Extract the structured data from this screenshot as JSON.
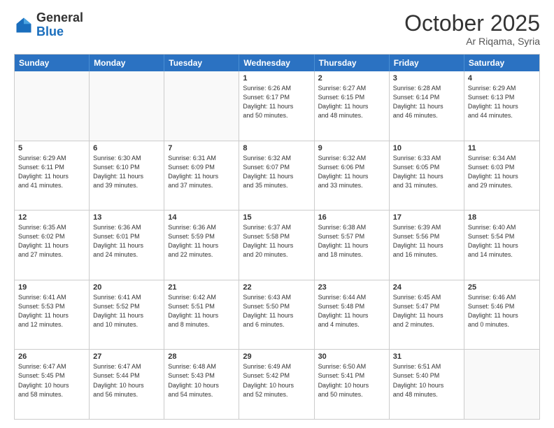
{
  "header": {
    "logo_general": "General",
    "logo_blue": "Blue",
    "month_title": "October 2025",
    "location": "Ar Riqama, Syria"
  },
  "days_of_week": [
    "Sunday",
    "Monday",
    "Tuesday",
    "Wednesday",
    "Thursday",
    "Friday",
    "Saturday"
  ],
  "weeks": [
    [
      {
        "day": "",
        "info": ""
      },
      {
        "day": "",
        "info": ""
      },
      {
        "day": "",
        "info": ""
      },
      {
        "day": "1",
        "info": "Sunrise: 6:26 AM\nSunset: 6:17 PM\nDaylight: 11 hours\nand 50 minutes."
      },
      {
        "day": "2",
        "info": "Sunrise: 6:27 AM\nSunset: 6:15 PM\nDaylight: 11 hours\nand 48 minutes."
      },
      {
        "day": "3",
        "info": "Sunrise: 6:28 AM\nSunset: 6:14 PM\nDaylight: 11 hours\nand 46 minutes."
      },
      {
        "day": "4",
        "info": "Sunrise: 6:29 AM\nSunset: 6:13 PM\nDaylight: 11 hours\nand 44 minutes."
      }
    ],
    [
      {
        "day": "5",
        "info": "Sunrise: 6:29 AM\nSunset: 6:11 PM\nDaylight: 11 hours\nand 41 minutes."
      },
      {
        "day": "6",
        "info": "Sunrise: 6:30 AM\nSunset: 6:10 PM\nDaylight: 11 hours\nand 39 minutes."
      },
      {
        "day": "7",
        "info": "Sunrise: 6:31 AM\nSunset: 6:09 PM\nDaylight: 11 hours\nand 37 minutes."
      },
      {
        "day": "8",
        "info": "Sunrise: 6:32 AM\nSunset: 6:07 PM\nDaylight: 11 hours\nand 35 minutes."
      },
      {
        "day": "9",
        "info": "Sunrise: 6:32 AM\nSunset: 6:06 PM\nDaylight: 11 hours\nand 33 minutes."
      },
      {
        "day": "10",
        "info": "Sunrise: 6:33 AM\nSunset: 6:05 PM\nDaylight: 11 hours\nand 31 minutes."
      },
      {
        "day": "11",
        "info": "Sunrise: 6:34 AM\nSunset: 6:03 PM\nDaylight: 11 hours\nand 29 minutes."
      }
    ],
    [
      {
        "day": "12",
        "info": "Sunrise: 6:35 AM\nSunset: 6:02 PM\nDaylight: 11 hours\nand 27 minutes."
      },
      {
        "day": "13",
        "info": "Sunrise: 6:36 AM\nSunset: 6:01 PM\nDaylight: 11 hours\nand 24 minutes."
      },
      {
        "day": "14",
        "info": "Sunrise: 6:36 AM\nSunset: 5:59 PM\nDaylight: 11 hours\nand 22 minutes."
      },
      {
        "day": "15",
        "info": "Sunrise: 6:37 AM\nSunset: 5:58 PM\nDaylight: 11 hours\nand 20 minutes."
      },
      {
        "day": "16",
        "info": "Sunrise: 6:38 AM\nSunset: 5:57 PM\nDaylight: 11 hours\nand 18 minutes."
      },
      {
        "day": "17",
        "info": "Sunrise: 6:39 AM\nSunset: 5:56 PM\nDaylight: 11 hours\nand 16 minutes."
      },
      {
        "day": "18",
        "info": "Sunrise: 6:40 AM\nSunset: 5:54 PM\nDaylight: 11 hours\nand 14 minutes."
      }
    ],
    [
      {
        "day": "19",
        "info": "Sunrise: 6:41 AM\nSunset: 5:53 PM\nDaylight: 11 hours\nand 12 minutes."
      },
      {
        "day": "20",
        "info": "Sunrise: 6:41 AM\nSunset: 5:52 PM\nDaylight: 11 hours\nand 10 minutes."
      },
      {
        "day": "21",
        "info": "Sunrise: 6:42 AM\nSunset: 5:51 PM\nDaylight: 11 hours\nand 8 minutes."
      },
      {
        "day": "22",
        "info": "Sunrise: 6:43 AM\nSunset: 5:50 PM\nDaylight: 11 hours\nand 6 minutes."
      },
      {
        "day": "23",
        "info": "Sunrise: 6:44 AM\nSunset: 5:48 PM\nDaylight: 11 hours\nand 4 minutes."
      },
      {
        "day": "24",
        "info": "Sunrise: 6:45 AM\nSunset: 5:47 PM\nDaylight: 11 hours\nand 2 minutes."
      },
      {
        "day": "25",
        "info": "Sunrise: 6:46 AM\nSunset: 5:46 PM\nDaylight: 11 hours\nand 0 minutes."
      }
    ],
    [
      {
        "day": "26",
        "info": "Sunrise: 6:47 AM\nSunset: 5:45 PM\nDaylight: 10 hours\nand 58 minutes."
      },
      {
        "day": "27",
        "info": "Sunrise: 6:47 AM\nSunset: 5:44 PM\nDaylight: 10 hours\nand 56 minutes."
      },
      {
        "day": "28",
        "info": "Sunrise: 6:48 AM\nSunset: 5:43 PM\nDaylight: 10 hours\nand 54 minutes."
      },
      {
        "day": "29",
        "info": "Sunrise: 6:49 AM\nSunset: 5:42 PM\nDaylight: 10 hours\nand 52 minutes."
      },
      {
        "day": "30",
        "info": "Sunrise: 6:50 AM\nSunset: 5:41 PM\nDaylight: 10 hours\nand 50 minutes."
      },
      {
        "day": "31",
        "info": "Sunrise: 6:51 AM\nSunset: 5:40 PM\nDaylight: 10 hours\nand 48 minutes."
      },
      {
        "day": "",
        "info": ""
      }
    ]
  ]
}
